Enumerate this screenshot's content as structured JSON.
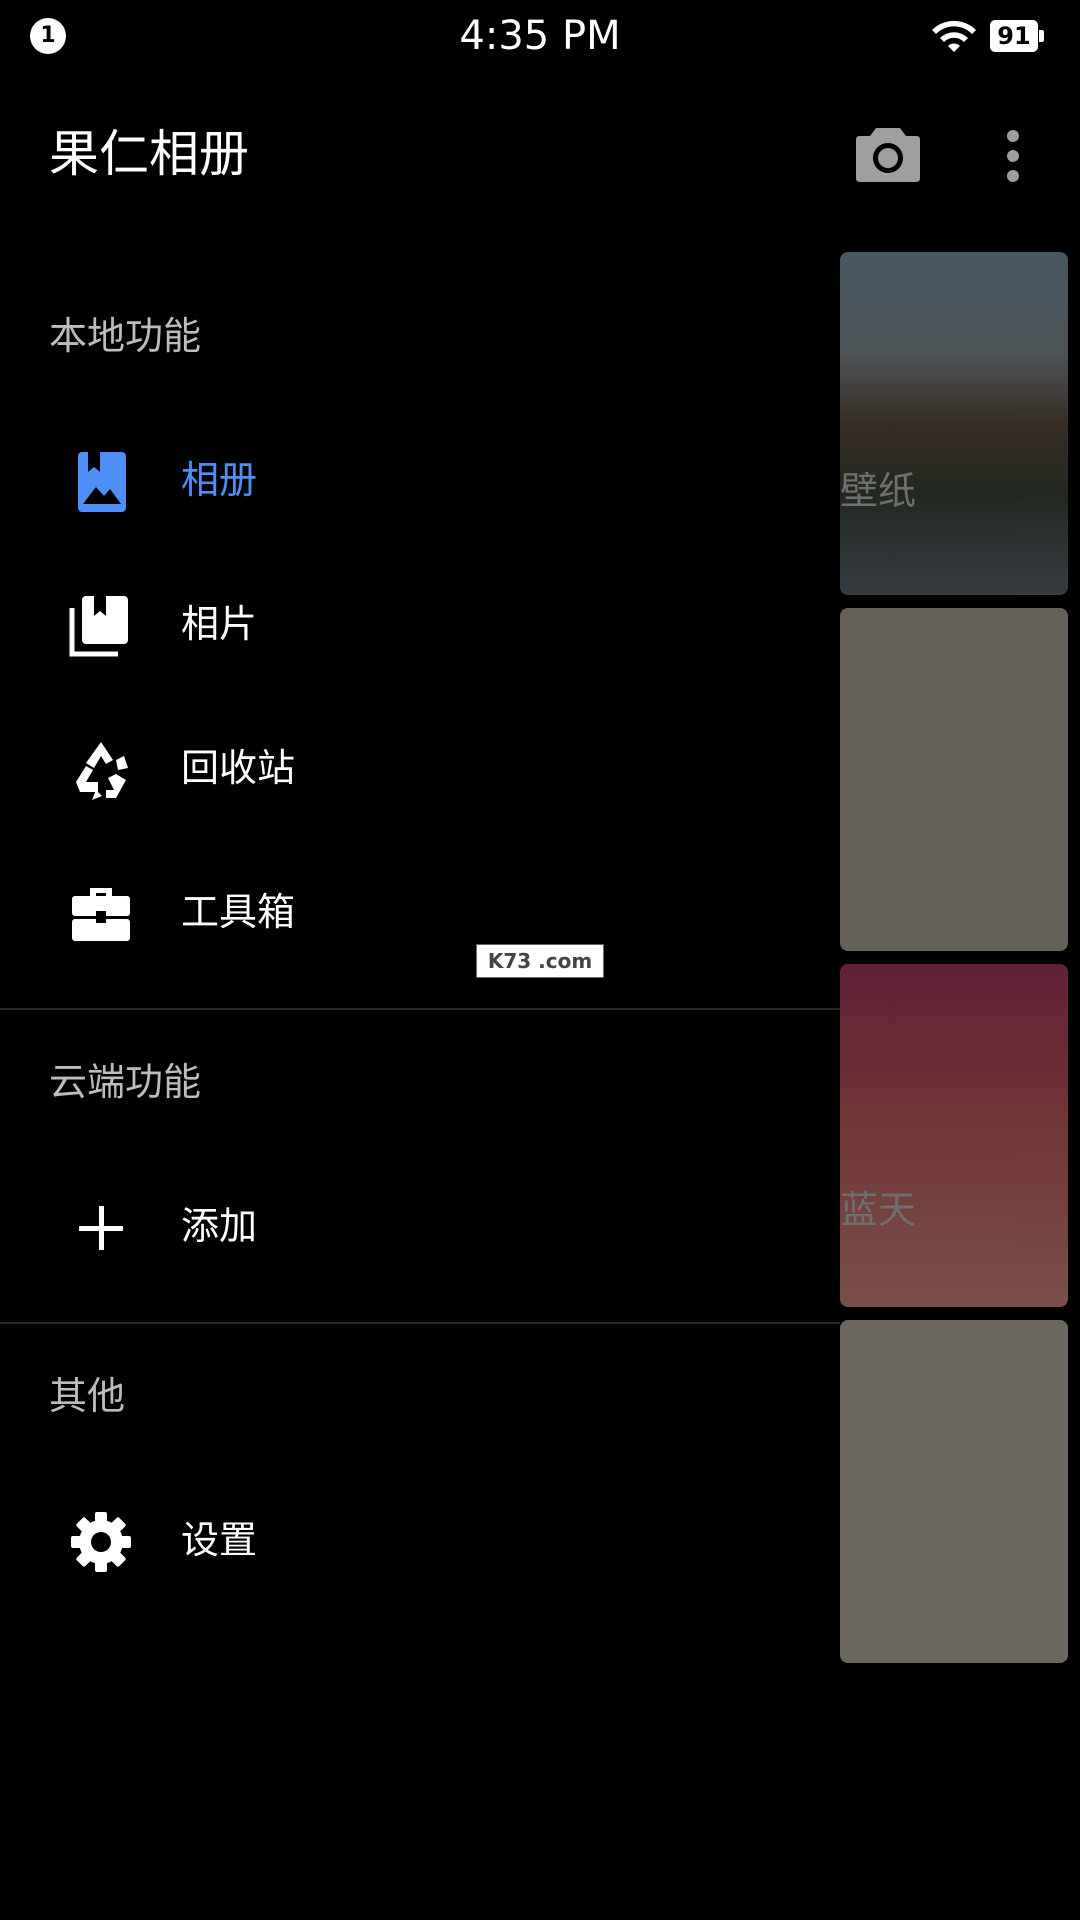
{
  "status_bar": {
    "notification_count": "1",
    "time": "4:35 PM",
    "battery": "91",
    "wifi_icon": "wifi-icon"
  },
  "app_bar": {
    "title": "果仁相册",
    "camera_icon": "camera-icon",
    "more_icon": "more-vert-icon"
  },
  "drawer": {
    "sections": [
      {
        "header": "本地功能",
        "items": [
          {
            "label": "相册",
            "icon": "photo-album-icon",
            "active": true
          },
          {
            "label": "相片",
            "icon": "photo-library-icon",
            "active": false
          },
          {
            "label": "回收站",
            "icon": "recycle-icon",
            "active": false
          },
          {
            "label": "工具箱",
            "icon": "toolbox-icon",
            "active": false
          }
        ]
      },
      {
        "header": "云端功能",
        "items": [
          {
            "label": "添加",
            "icon": "add-icon",
            "active": false
          }
        ]
      },
      {
        "header": "其他",
        "items": [
          {
            "label": "设置",
            "icon": "settings-icon",
            "active": false
          }
        ]
      }
    ],
    "active_color": "#4e8ef7"
  },
  "gallery": {
    "cards": [
      {
        "label": "壁纸"
      },
      {
        "label": ""
      },
      {
        "label": "蓝天"
      },
      {
        "label": ""
      }
    ]
  },
  "watermark": {
    "text": "K73 .com"
  }
}
